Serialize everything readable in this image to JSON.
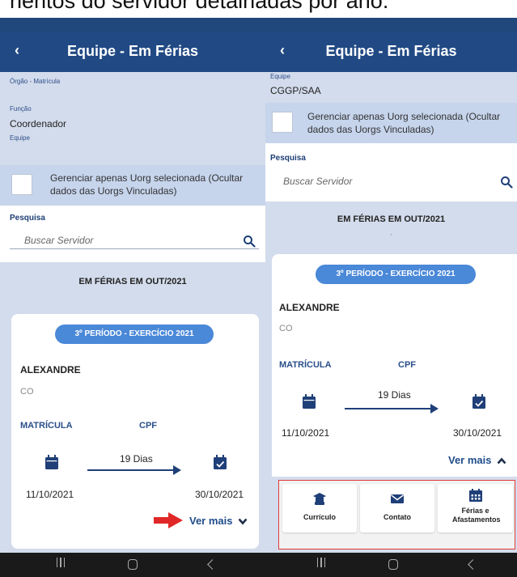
{
  "caption": "nentos do servidor detalhadas por ano.",
  "left": {
    "header": {
      "back": "‹",
      "title": "Equipe - Em Férias"
    },
    "orgao_label": "Órgão - Matrícula",
    "funcao_label": "Função",
    "funcao_value": "Coordenador",
    "equipe_label": "Equipe",
    "checkbox_label": "Gerenciar apenas Uorg selecionada (Ocultar dados das Uorgs Vinculadas)",
    "search": {
      "label": "Pesquisa",
      "placeholder": "Buscar Servidor"
    },
    "section_title": "EM FÉRIAS EM OUT/2021",
    "card": {
      "period": "3º PERÍODO - EXERCÍCIO 2021",
      "name": "ALEXANDRE",
      "subname": "CO",
      "matricula_label": "MATRÍCULA",
      "cpf_label": "CPF",
      "days": "19 Dias",
      "start_date": "11/10/2021",
      "end_date": "30/10/2021",
      "ver_mais": "Ver mais"
    }
  },
  "right": {
    "header": {
      "back": "‹",
      "title": "Equipe - Em Férias"
    },
    "equipe_label": "Equipe",
    "equipe_value": "CGGP/SAA",
    "checkbox_label": "Gerenciar apenas Uorg selecionada (Ocultar dados das Uorgs Vinculadas)",
    "search": {
      "label": "Pesquisa",
      "placeholder": "Buscar Servidor"
    },
    "section_title": "EM FÉRIAS EM OUT/2021",
    "section_sub": "·",
    "card": {
      "period": "3º PERÍODO - EXERCÍCIO 2021",
      "name": "ALEXANDRE",
      "subname": "CO",
      "matricula_label": "MATRÍCULA",
      "cpf_label": "CPF",
      "days": "19 Dias",
      "start_date": "11/10/2021",
      "end_date": "30/10/2021",
      "ver_mais": "Ver mais"
    },
    "actions": [
      {
        "icon": "graduation-icon",
        "label": "Currículo"
      },
      {
        "icon": "envelope-icon",
        "label": "Contato"
      },
      {
        "icon": "calendar-grid-icon",
        "label": "Férias e Afastamentos"
      }
    ]
  },
  "colors": {
    "appbar": "#214a84",
    "accent": "#4a88d8",
    "highlight": "#e03a3a"
  }
}
